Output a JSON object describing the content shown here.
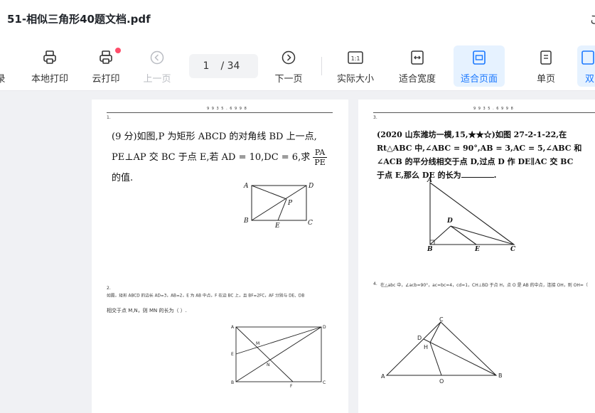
{
  "title_bar": {
    "doc_title": "51-相似三角形40题文档.pdf",
    "right_glyph": "こ"
  },
  "toolbar": {
    "items": [
      {
        "label": "录",
        "icon": "catalog-icon",
        "state": "normal"
      },
      {
        "label": "本地打印",
        "icon": "printer-icon",
        "state": "normal"
      },
      {
        "label": "云打印",
        "icon": "cloud-printer-icon",
        "state": "normal",
        "badge": true
      },
      {
        "label": "上一页",
        "icon": "previous-page-icon",
        "state": "disabled"
      },
      {
        "label": "下一页",
        "icon": "next-page-icon",
        "state": "normal"
      },
      {
        "label": "实际大小",
        "icon": "actual-size-icon",
        "icon_text": "1:1",
        "state": "normal"
      },
      {
        "label": "适合宽度",
        "icon": "fit-width-icon",
        "state": "normal"
      },
      {
        "label": "适合页面",
        "icon": "fit-page-icon",
        "state": "active"
      },
      {
        "label": "单页",
        "icon": "single-page-icon",
        "state": "normal"
      },
      {
        "label": "双",
        "icon": "double-page-icon",
        "state": "active"
      }
    ],
    "pager": {
      "current": "1",
      "total": "/ 34"
    }
  },
  "pages": {
    "left": {
      "header_mark": "9 9 3 5 . 6 9 9 8",
      "q1": {
        "number": "1.",
        "text_line1": "(9 分)如图,P 为矩形 ABCD 的对角线 BD 上一点,",
        "text_line2_before": "PE⊥AP 交 BC 于点 E,若 AD = 10,DC = 6,求",
        "frac_num": "PA",
        "frac_den": "PE",
        "text_line3": "的值.",
        "labels": {
          "A": "A",
          "B": "B",
          "C": "C",
          "D": "D",
          "E": "E",
          "P": "P"
        }
      },
      "q2": {
        "number": "2.",
        "line1": "如图，矩形 ABCD 的边长 AD=3，AB=2，E 为 AB 中点，F 在边 BC 上，且 BF=2FC，AF 分别与 DE、DB",
        "line2": "相交于点 M,N，则 MN 的长为（        ）.",
        "labels": {
          "A": "A",
          "B": "B",
          "C": "C",
          "D": "D",
          "E": "E",
          "F": "F",
          "M": "M",
          "N": "N"
        }
      }
    },
    "right": {
      "header_mark": "9 9 3 5 . 6 9 9 8",
      "q3": {
        "number": "3.",
        "line1": "(2020 山东潍坊一模,15,★★☆)如图 27-2-1-22,在",
        "line2": "Rt△ABC 中,∠ABC = 90°,AB = 3,AC = 5,∠ABC 和",
        "line3": "∠ACB 的平分线相交于点 D,过点 D 作 DE∥AC 交 BC",
        "line4_before": "于点 E,那么 DE 的长为",
        "line4_after": ".",
        "labels": {
          "A": "A",
          "B": "B",
          "C": "C",
          "D": "D",
          "E": "E"
        }
      },
      "q4": {
        "number": "4.",
        "line1": "在△abc 中，∠acb=90°，ac=bc=4，cd=1，CH⊥BD 于点 H，点 O 是 AB 的中点，连接 OH，则 OH=（",
        "labels": {
          "A": "A",
          "B": "B",
          "C": "C",
          "D": "D",
          "H": "H",
          "O": "O"
        }
      }
    }
  }
}
